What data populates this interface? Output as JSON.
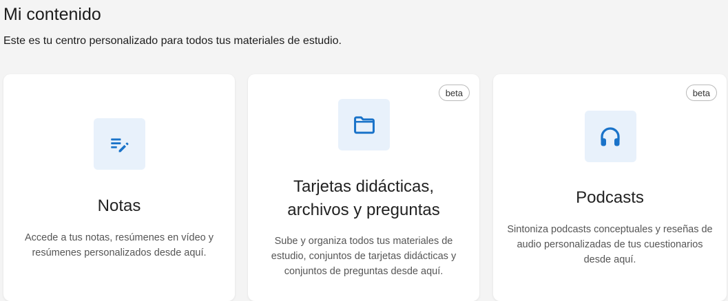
{
  "header": {
    "title": "Mi contenido",
    "subtitle": "Este es tu centro personalizado para todos tus materiales de estudio."
  },
  "colors": {
    "accent": "#1a73c9",
    "icon_tile_bg": "#e8f1fb",
    "page_bg": "#f4f4f4",
    "card_bg": "#ffffff"
  },
  "cards": [
    {
      "icon": "notes-edit-icon",
      "title": "Notas",
      "description": "Accede a tus notas, resúmenes en vídeo y resúmenes personalizados desde aquí.",
      "badge": ""
    },
    {
      "icon": "folder-icon",
      "title": "Tarjetas didácticas, archivos y preguntas",
      "description": "Sube y organiza todos tus materiales de estudio, conjuntos de tarjetas didácticas y conjuntos de preguntas desde aquí.",
      "badge": "beta"
    },
    {
      "icon": "headphones-icon",
      "title": "Podcasts",
      "description": "Sintoniza podcasts conceptuales y reseñas de audio personalizadas de tus cuestionarios desde aquí.",
      "badge": "beta"
    }
  ]
}
